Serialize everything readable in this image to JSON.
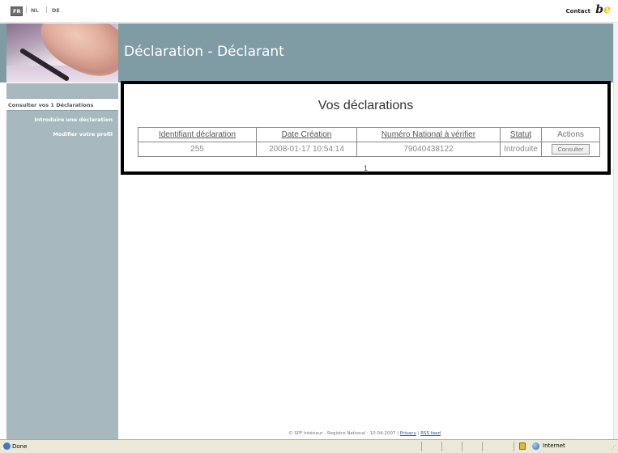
{
  "topbar": {
    "languages": [
      "FR",
      "NL",
      "DE"
    ],
    "active_language": "FR",
    "contact_label": "Contact",
    "logo_text_b": "b",
    "logo_text_e": "e"
  },
  "banner": {
    "title": "Déclaration - Déclarant"
  },
  "sidebar": {
    "items": [
      {
        "label": "Consulter vos 1 Déclarations",
        "active": true
      },
      {
        "label": "Introduire une déclaration",
        "active": false
      },
      {
        "label": "Modifier votre profil",
        "active": false
      }
    ]
  },
  "main": {
    "title": "Vos déclarations",
    "columns": [
      "Identifiant déclaration",
      "Date Création",
      "Numéro National à vérifier",
      "Statut",
      "Actions"
    ],
    "rows": [
      {
        "id": "255",
        "date": "2008-01-17 10:54:14",
        "national_number": "79040438122",
        "status": "Introduite",
        "action_label": "Consulter"
      }
    ],
    "page": "1"
  },
  "footer": {
    "copyright": "© SPF Intérieur - Registre National : 10-04-2007",
    "separator": "|",
    "privacy": "Privacy",
    "rss": "RSS feed"
  },
  "statusbar": {
    "status": "Done",
    "zone": "Internet"
  },
  "colors": {
    "banner": "#7f9ba4",
    "sidebar": "#a7b9bf",
    "content_border": "#000000"
  }
}
